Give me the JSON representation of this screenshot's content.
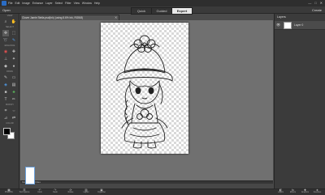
{
  "menu": [
    "File",
    "Edit",
    "Image",
    "Enhance",
    "Layer",
    "Select",
    "Filter",
    "View",
    "Window",
    "Help"
  ],
  "window_controls": [
    "—",
    "□",
    "✕"
  ],
  "modebar": {
    "open_label": "Open",
    "modes": [
      "Quick",
      "Guided",
      "Expert"
    ],
    "active_mode": "Expert",
    "create_label": "Create"
  },
  "tool_sections": [
    "VIEW",
    "SELECT",
    "ENHANCE",
    "DRAW",
    "MODIFY",
    "COLOR"
  ],
  "document": {
    "tab_title": "Clover Jamie Stella.psd(Ink) (using 8.6% Ink, RGB/8)",
    "close_glyph": "✕"
  },
  "layers": {
    "tab_label": "Layers",
    "items": [
      {
        "name": "Layer 0",
        "visible": true
      }
    ]
  },
  "project_bin": {
    "label": "Show Open Files"
  },
  "taskbar": [
    {
      "icon": "photo-bin-icon",
      "label": "Photo Bin"
    },
    {
      "icon": "tool-options-icon",
      "label": "Tool Options"
    },
    {
      "icon": "undo-icon",
      "label": "Undo"
    },
    {
      "icon": "redo-icon",
      "label": "Redo"
    },
    {
      "icon": "rotate-icon",
      "label": "Rotate"
    },
    {
      "icon": "layout-icon",
      "label": "Layout"
    },
    {
      "icon": "organizer-icon",
      "label": "Organizer"
    }
  ],
  "panelbar": [
    {
      "icon": "layers-icon",
      "label": "Layers"
    },
    {
      "icon": "effects-icon",
      "label": "Effects"
    },
    {
      "icon": "graphics-icon",
      "label": "Graphics"
    },
    {
      "icon": "favorites-icon",
      "label": "Favorites"
    },
    {
      "icon": "more-icon",
      "label": "More"
    }
  ],
  "colors": {
    "accent": "#2a6cc4",
    "foreground_swatch": "#000000",
    "background_swatch": "#ffffff"
  }
}
